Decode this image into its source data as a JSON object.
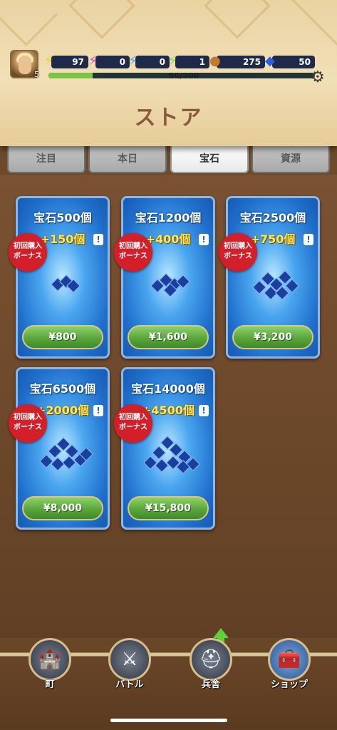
{
  "hud": {
    "level": "5",
    "stats": [
      {
        "icon": "energy-yellow-icon",
        "value": "97",
        "color": "#f2d21f"
      },
      {
        "icon": "energy-pink-icon",
        "value": "0",
        "color": "#e247c9"
      },
      {
        "icon": "energy-blue-icon",
        "value": "0",
        "color": "#3fa9f5"
      },
      {
        "icon": "energy-green-icon",
        "value": "1",
        "color": "#7be04a"
      },
      {
        "icon": "coin-icon",
        "value": "275",
        "color": "#c47a2c"
      },
      {
        "icon": "gem-icon",
        "value": "50",
        "color": "#2a5fe0"
      }
    ],
    "xp_text": "50/300",
    "xp_fraction": 0.1667
  },
  "title": "ストア",
  "tabs": [
    "注目",
    "本日",
    "宝石",
    "資源"
  ],
  "active_tab": 2,
  "badge_text": [
    "初回購入",
    "ボーナス"
  ],
  "items": [
    {
      "name": "宝石500個",
      "bonus": "+150個",
      "price": "¥800"
    },
    {
      "name": "宝石1200個",
      "bonus": "+400個",
      "price": "¥1,600"
    },
    {
      "name": "宝石2500個",
      "bonus": "+750個",
      "price": "¥3,200"
    },
    {
      "name": "宝石6500個",
      "bonus": "+2000個",
      "price": "¥8,000"
    },
    {
      "name": "宝石14000個",
      "bonus": "+4500個",
      "price": "¥15,800"
    }
  ],
  "info_glyph": "!",
  "nav": [
    {
      "label": "町",
      "icon": "castle-icon"
    },
    {
      "label": "バトル",
      "icon": "crossed-swords-icon"
    },
    {
      "label": "兵舎",
      "icon": "helmet-icon"
    },
    {
      "label": "ショップ",
      "icon": "treasure-chest-icon"
    }
  ],
  "colors": {
    "card_blue": "#1f6fcb",
    "price_green": "#5aa53c",
    "badge_red": "#d21f2a",
    "bonus_yellow": "#ffe85a"
  }
}
